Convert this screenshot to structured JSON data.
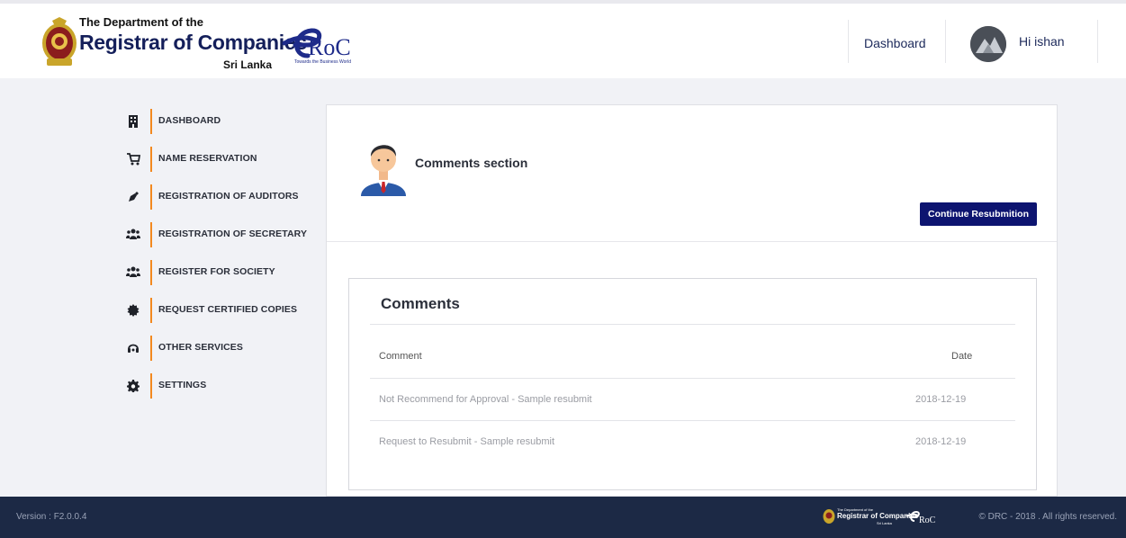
{
  "header": {
    "logo": {
      "line1": "The Department of the",
      "line2": "Registrar of Companies",
      "line3": "Sri Lanka",
      "eroc_text": "RoC",
      "eroc_tagline": "Towards the Business World"
    },
    "nav_dashboard": "Dashboard",
    "greeting": "Hi ishan"
  },
  "sidebar": {
    "items": [
      {
        "label": "DASHBOARD",
        "icon": "building-icon"
      },
      {
        "label": "NAME RESERVATION",
        "icon": "cart-icon"
      },
      {
        "label": "REGISTRATION OF AUDITORS",
        "icon": "pen-icon"
      },
      {
        "label": "REGISTRATION OF SECRETARY",
        "icon": "users-icon"
      },
      {
        "label": "REGISTER FOR SOCIETY",
        "icon": "users-icon"
      },
      {
        "label": "REQUEST CERTIFIED COPIES",
        "icon": "certificate-icon"
      },
      {
        "label": "OTHER SERVICES",
        "icon": "headset-icon"
      },
      {
        "label": "SETTINGS",
        "icon": "gear-icon"
      }
    ]
  },
  "main": {
    "section_title": "Comments section",
    "continue_button": "Continue Resubmition",
    "comments": {
      "title": "Comments",
      "headers": {
        "comment": "Comment",
        "date": "Date"
      },
      "rows": [
        {
          "comment": "Not Recommend for Approval - Sample resubmit",
          "date": "2018-12-19"
        },
        {
          "comment": "Request to Resubmit - Sample resubmit",
          "date": "2018-12-19"
        }
      ]
    }
  },
  "footer": {
    "version": "Version : F2.0.0.4",
    "copyright": "© DRC - 2018 . All rights reserved.",
    "logo": {
      "line1": "The Department of the",
      "line2": "Registrar of Companies",
      "line3": "Sri Lanka",
      "eroc_text": "RoC"
    }
  },
  "colors": {
    "accent_orange": "#f3891f",
    "primary_navy": "#0d1470",
    "footer_bg": "#1c2945",
    "page_bg": "#f1f2f6"
  }
}
